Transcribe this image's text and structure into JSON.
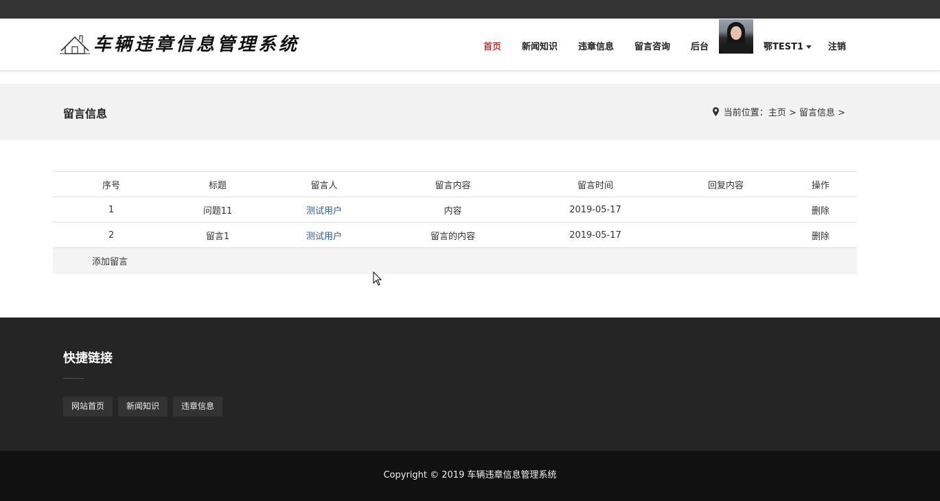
{
  "site": {
    "name": "车辆违章信息管理系统"
  },
  "nav": {
    "items": [
      {
        "label": "首页",
        "active": true
      },
      {
        "label": "新闻知识"
      },
      {
        "label": "违章信息"
      },
      {
        "label": "留言咨询"
      },
      {
        "label": "后台"
      }
    ],
    "user": "鄂TEST1",
    "logout": "注销"
  },
  "page": {
    "title": "留言信息",
    "breadcrumb_prefix": "当前位置：",
    "breadcrumb": "主页 > 留言信息 >"
  },
  "table": {
    "headers": [
      "序号",
      "标题",
      "留言人",
      "留言内容",
      "留言时间",
      "回复内容",
      "操作"
    ],
    "rows": [
      {
        "no": "1",
        "title": "问题11",
        "author": "测试用户",
        "content": "内容",
        "time": "2019-05-17",
        "reply": "",
        "action": "删除"
      },
      {
        "no": "2",
        "title": "留言1",
        "author": "测试用户",
        "content": "留言的内容",
        "time": "2019-05-17",
        "reply": "",
        "action": "删除"
      }
    ],
    "add_label": "添加留言"
  },
  "footer": {
    "quick_title": "快捷链接",
    "links": [
      "网站首页",
      "新闻知识",
      "违章信息"
    ],
    "copyright": "Copyright © 2019 车辆违章信息管理系统"
  },
  "colors": {
    "topbar": "#333333",
    "active_nav": "#dd3333",
    "footer": "#252525",
    "copyright_bar": "#111111",
    "link": "#2b5c9e"
  }
}
